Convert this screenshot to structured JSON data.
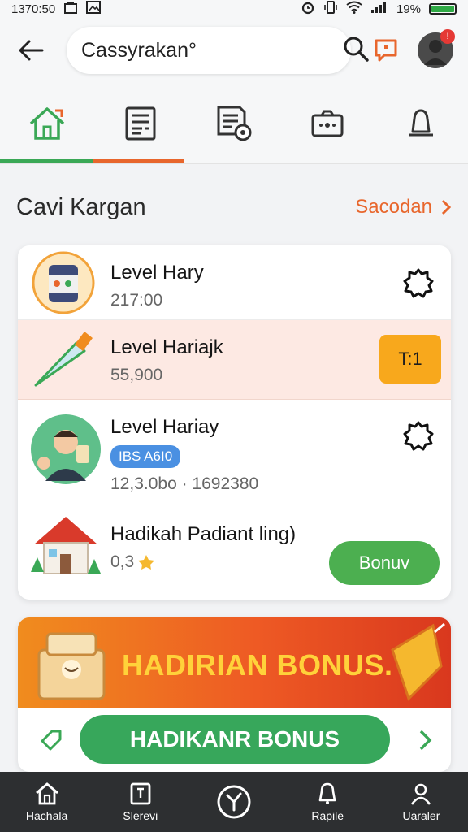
{
  "status_bar": {
    "time": "1370:50",
    "battery_percent": "19%"
  },
  "top_bar": {
    "search_value": "Cassyrakan°",
    "notification_badge": "!"
  },
  "tabs": [
    {
      "icon": "home-icon"
    },
    {
      "icon": "list-icon"
    },
    {
      "icon": "document-icon"
    },
    {
      "icon": "camera-icon"
    },
    {
      "icon": "bell-icon"
    }
  ],
  "section": {
    "title": "Cavi Kargan",
    "link": "Sacodan"
  },
  "list": [
    {
      "title": "Level Hary",
      "subtitle": "217:00",
      "icon": "jar-icon",
      "action": "gear-icon"
    },
    {
      "title": "Level Hariajk",
      "subtitle": "55,900",
      "icon": "cone-icon",
      "action_label": "T:1"
    },
    {
      "title": "Level Hariay",
      "tag": "IBS A6I0",
      "subtitle": "12,3.0bo · 1692380",
      "icon": "person-icon",
      "action": "gear-icon"
    },
    {
      "title": "Hadikah Padiant ling)",
      "subtitle": "0,3",
      "icon": "house-icon",
      "button_label": "Bonuv"
    }
  ],
  "banner": {
    "headline": "HADIRIAN BONUS.",
    "cta_label": "HADIKANR BONUS"
  },
  "bottom_nav": [
    {
      "label": "Hachala",
      "icon": "home-icon"
    },
    {
      "label": "Slerevi",
      "icon": "book-icon"
    },
    {
      "label": "",
      "icon": "clock-icon"
    },
    {
      "label": "Rapile",
      "icon": "bell-icon"
    },
    {
      "label": "Uaraler",
      "icon": "user-icon"
    }
  ],
  "colors": {
    "accent_green": "#3aa856",
    "accent_orange": "#e8662c",
    "nav_bg": "#2d2f31"
  }
}
